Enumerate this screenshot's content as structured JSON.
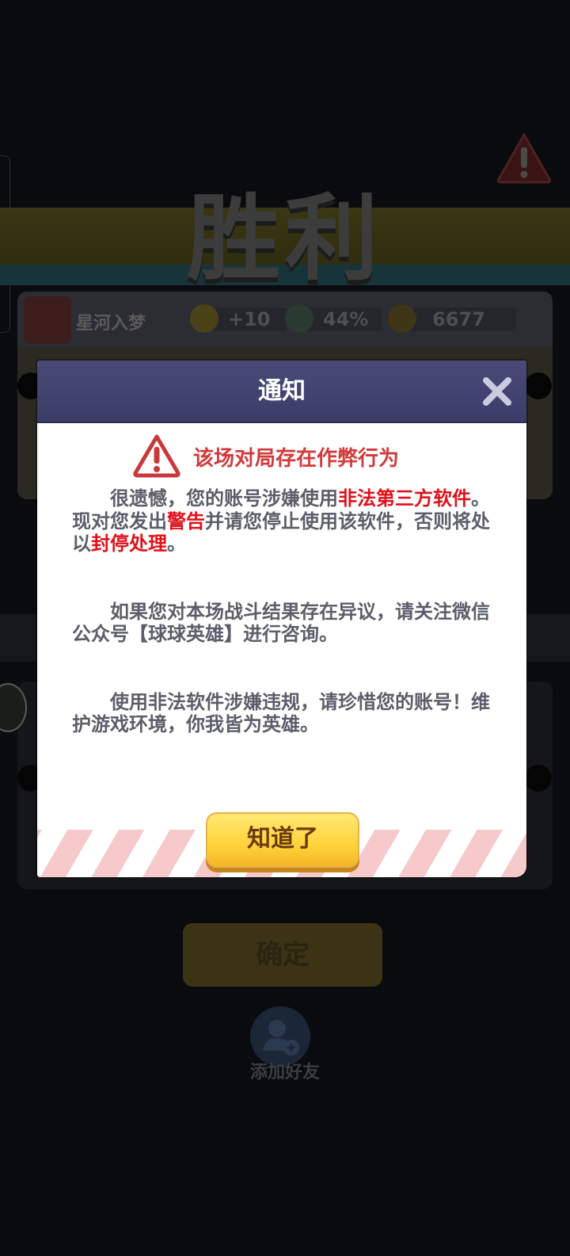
{
  "background": {
    "victory_title": "胜利",
    "player": {
      "name": "星河入梦",
      "exp": "+10",
      "win_rate": "44%",
      "trophies": "6677"
    },
    "confirm_label": "确定",
    "add_friend_label": "添加好友"
  },
  "dialog": {
    "title": "通知",
    "warning_heading": "该场对局存在作弊行为",
    "para1": {
      "t1": "很遗憾，您的账号涉嫌使用",
      "h1": "非法第三方软件",
      "t2": "。现对您发出",
      "h2": "警告",
      "t3": "并请您停止使用该软件，否则将处以",
      "h3": "封停处理",
      "t4": "。"
    },
    "para2": "如果您对本场战斗结果存在异议，请关注微信公众号【球球英雄】进行咨询。",
    "para3": "使用非法软件涉嫌违规，请珍惜您的账号！维护游戏环境，你我皆为英雄。",
    "ok_label": "知道了"
  },
  "colors": {
    "header_bg": "#4a4a78",
    "warning_red": "#d23a3a",
    "highlight_red": "#e0101a",
    "button_yellow": "#ffd33a",
    "stripe_pink": "#f6c9cb"
  }
}
